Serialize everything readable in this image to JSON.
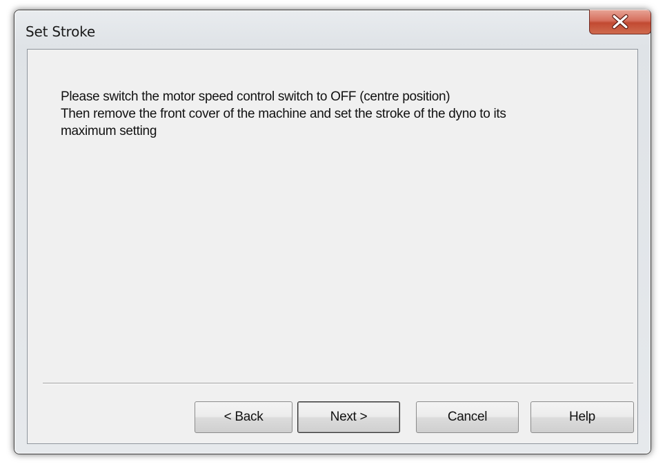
{
  "window": {
    "title": "Set Stroke",
    "close_icon": "close-x-icon"
  },
  "message": {
    "lines": [
      "Please switch the motor speed control switch to OFF (centre position)",
      "Then remove the front cover of the machine and set the stroke of the dyno to its",
      "maximum setting"
    ]
  },
  "buttons": {
    "back": "< Back",
    "next": "Next >",
    "cancel": "Cancel",
    "help": "Help"
  },
  "colors": {
    "close_button": "#c24a32",
    "dialog_background": "#f0f0f0"
  }
}
